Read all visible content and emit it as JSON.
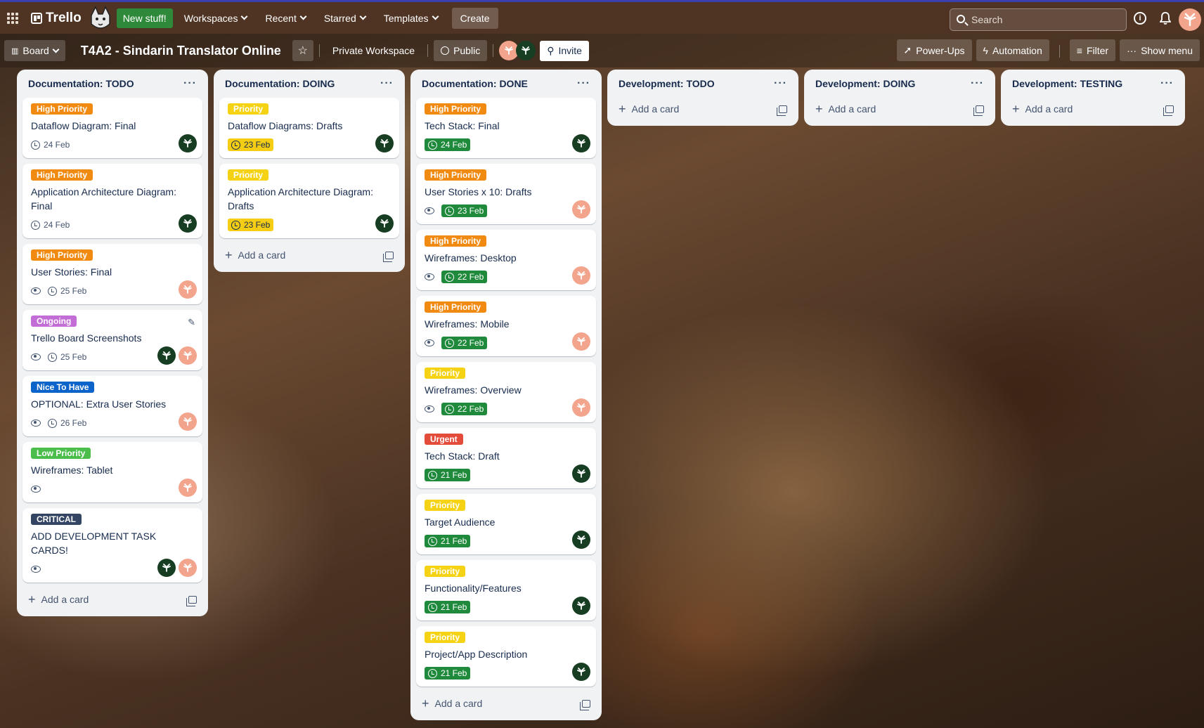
{
  "topnav": {
    "logo": "Trello",
    "new_stuff": "New stuff!",
    "workspaces": "Workspaces",
    "recent": "Recent",
    "starred": "Starred",
    "templates": "Templates",
    "create": "Create",
    "search_placeholder": "Search"
  },
  "boardbar": {
    "view": "Board",
    "title": "T4A2 - Sindarin Translator Online",
    "workspace": "Private Workspace",
    "visibility": "Public",
    "invite": "Invite",
    "power_ups": "Power-Ups",
    "automation": "Automation",
    "filter": "Filter",
    "show_menu": "Show menu"
  },
  "colors": {
    "high_priority": "#f08a10",
    "priority": "#f5d214",
    "ongoing": "#c36ed6",
    "nice_to_have": "#0c63c9",
    "low_priority": "#4bbd4b",
    "critical": "#344563",
    "urgent": "#e34c3a",
    "due_complete": "#1f8a3c",
    "due_soon": "#f5cd14"
  },
  "add_card": "Add a card",
  "lists": [
    {
      "title": "Documentation: TODO",
      "cards": [
        {
          "label": "High Priority",
          "title": "Dataflow Diagram: Final",
          "due": "24 Feb",
          "watch": false,
          "members": [
            "dark"
          ]
        },
        {
          "label": "High Priority",
          "title": "Application Architecture Diagram: Final",
          "due": "24 Feb",
          "watch": false,
          "members": [
            "dark"
          ]
        },
        {
          "label": "High Priority",
          "title": "User Stories: Final",
          "due": "25 Feb",
          "watch": true,
          "members": [
            "peach"
          ]
        },
        {
          "label": "Ongoing",
          "title": "Trello Board Screenshots",
          "due": "25 Feb",
          "watch": true,
          "members": [
            "dark",
            "peach"
          ]
        },
        {
          "label": "Nice To Have",
          "title": "OPTIONAL: Extra User Stories",
          "due": "26 Feb",
          "watch": true,
          "members": [
            "peach"
          ]
        },
        {
          "label": "Low Priority",
          "title": "Wireframes: Tablet",
          "due": "",
          "watch": true,
          "members": [
            "peach"
          ]
        },
        {
          "label": "CRITICAL",
          "title": "ADD DEVELOPMENT TASK CARDS!",
          "due": "",
          "watch": true,
          "members": [
            "dark",
            "peach"
          ]
        }
      ]
    },
    {
      "title": "Documentation: DOING",
      "cards": [
        {
          "label": "Priority",
          "title": "Dataflow Diagrams: Drafts",
          "due": "23 Feb",
          "watch": false,
          "members": [
            "dark"
          ]
        },
        {
          "label": "Priority",
          "title": "Application Architecture Diagram: Drafts",
          "due": "23 Feb",
          "watch": false,
          "members": [
            "dark"
          ]
        }
      ]
    },
    {
      "title": "Documentation: DONE",
      "cards": [
        {
          "label": "High Priority",
          "title": "Tech Stack: Final",
          "due": "24 Feb",
          "watch": false,
          "members": [
            "dark"
          ]
        },
        {
          "label": "High Priority",
          "title": "User Stories x 10: Drafts",
          "due": "23 Feb",
          "watch": true,
          "members": [
            "peach"
          ]
        },
        {
          "label": "High Priority",
          "title": "Wireframes: Desktop",
          "due": "22 Feb",
          "watch": true,
          "members": [
            "peach"
          ]
        },
        {
          "label": "High Priority",
          "title": "Wireframes: Mobile",
          "due": "22 Feb",
          "watch": true,
          "members": [
            "peach"
          ]
        },
        {
          "label": "Priority",
          "title": "Wireframes: Overview",
          "due": "22 Feb",
          "watch": true,
          "members": [
            "peach"
          ]
        },
        {
          "label": "Urgent",
          "title": "Tech Stack: Draft",
          "due": "21 Feb",
          "watch": false,
          "members": [
            "dark"
          ]
        },
        {
          "label": "Priority",
          "title": "Target Audience",
          "due": "21 Feb",
          "watch": false,
          "members": [
            "dark"
          ]
        },
        {
          "label": "Priority",
          "title": "Functionality/Features",
          "due": "21 Feb",
          "watch": false,
          "members": [
            "dark"
          ]
        },
        {
          "label": "Priority",
          "title": "Project/App Description",
          "due": "21 Feb",
          "watch": false,
          "members": [
            "dark"
          ]
        }
      ]
    },
    {
      "title": "Development: TODO",
      "cards": []
    },
    {
      "title": "Development: DOING",
      "cards": []
    },
    {
      "title": "Development: TESTING",
      "cards": []
    }
  ]
}
